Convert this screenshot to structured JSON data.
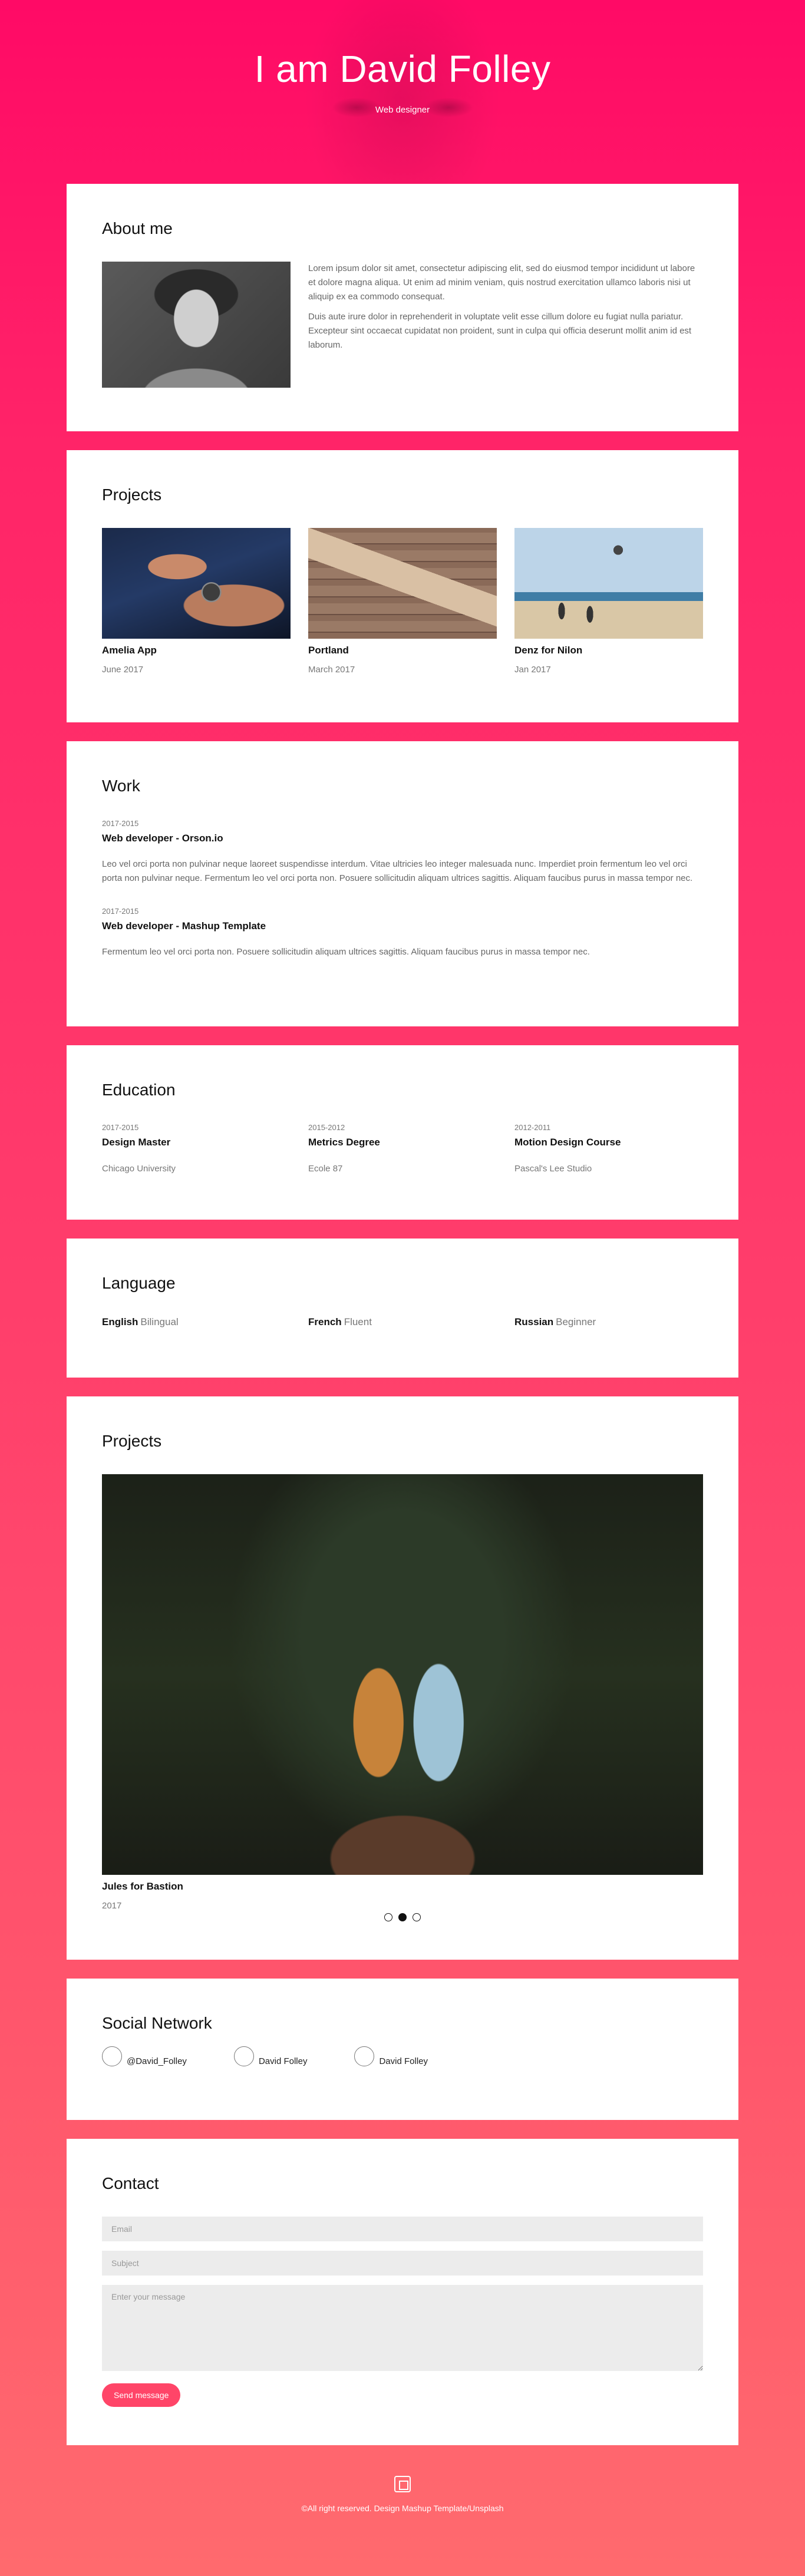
{
  "hero": {
    "title": "I am David Folley",
    "subtitle": "Web designer"
  },
  "about": {
    "heading": "About me",
    "paragraphs": [
      "Lorem ipsum dolor sit amet, consectetur adipiscing elit, sed do eiusmod tempor incididunt ut labore et dolore magna aliqua. Ut enim ad minim veniam, quis nostrud exercitation ullamco laboris nisi ut aliquip ex ea commodo consequat.",
      "Duis aute irure dolor in reprehenderit in voluptate velit esse cillum dolore eu fugiat nulla pariatur. Excepteur sint occaecat cupidatat non proident, sunt in culpa qui officia deserunt mollit anim id est laborum."
    ]
  },
  "projects": {
    "heading": "Projects",
    "items": [
      {
        "name": "Amelia App",
        "date": "June 2017"
      },
      {
        "name": "Portland",
        "date": "March 2017"
      },
      {
        "name": "Denz for Nilon",
        "date": "Jan 2017"
      }
    ]
  },
  "work": {
    "heading": "Work",
    "items": [
      {
        "date": "2017-2015",
        "title": "Web developer - Orson.io",
        "description": "Leo vel orci porta non pulvinar neque laoreet suspendisse interdum. Vitae ultricies leo integer malesuada nunc. Imperdiet proin fermentum leo vel orci porta non pulvinar neque. Fermentum leo vel orci porta non. Posuere sollicitudin aliquam ultrices sagittis. Aliquam faucibus purus in massa tempor nec."
      },
      {
        "date": "2017-2015",
        "title": "Web developer - Mashup Template",
        "description": "Fermentum leo vel orci porta non. Posuere sollicitudin aliquam ultrices sagittis. Aliquam faucibus purus in massa tempor nec."
      }
    ]
  },
  "education": {
    "heading": "Education",
    "items": [
      {
        "date": "2017-2015",
        "title": "Design Master",
        "school": "Chicago University"
      },
      {
        "date": "2015-2012",
        "title": "Metrics Degree",
        "school": "Ecole 87"
      },
      {
        "date": "2012-2011",
        "title": "Motion Design Course",
        "school": "Pascal's Lee Studio"
      }
    ]
  },
  "language": {
    "heading": "Language",
    "items": [
      {
        "name": "English",
        "level": "Bilingual"
      },
      {
        "name": "French",
        "level": "Fluent"
      },
      {
        "name": "Russian",
        "level": "Beginner"
      }
    ]
  },
  "slider": {
    "heading": "Projects",
    "current": {
      "name": "Jules for Bastion",
      "date": "2017"
    }
  },
  "social": {
    "heading": "Social Network",
    "items": [
      {
        "label": "@David_Folley"
      },
      {
        "label": "David Folley"
      },
      {
        "label": "David Folley"
      }
    ]
  },
  "contact": {
    "heading": "Contact",
    "email_placeholder": "Email",
    "subject_placeholder": "Subject",
    "message_placeholder": "Enter your message",
    "send_label": "Send message"
  },
  "footer": {
    "text": "©All right reserved. Design Mashup Template/Unsplash"
  },
  "colors": {
    "accent": "#ff4568",
    "background_top": "#ff0a66",
    "background_bottom": "#ff6a6e"
  }
}
